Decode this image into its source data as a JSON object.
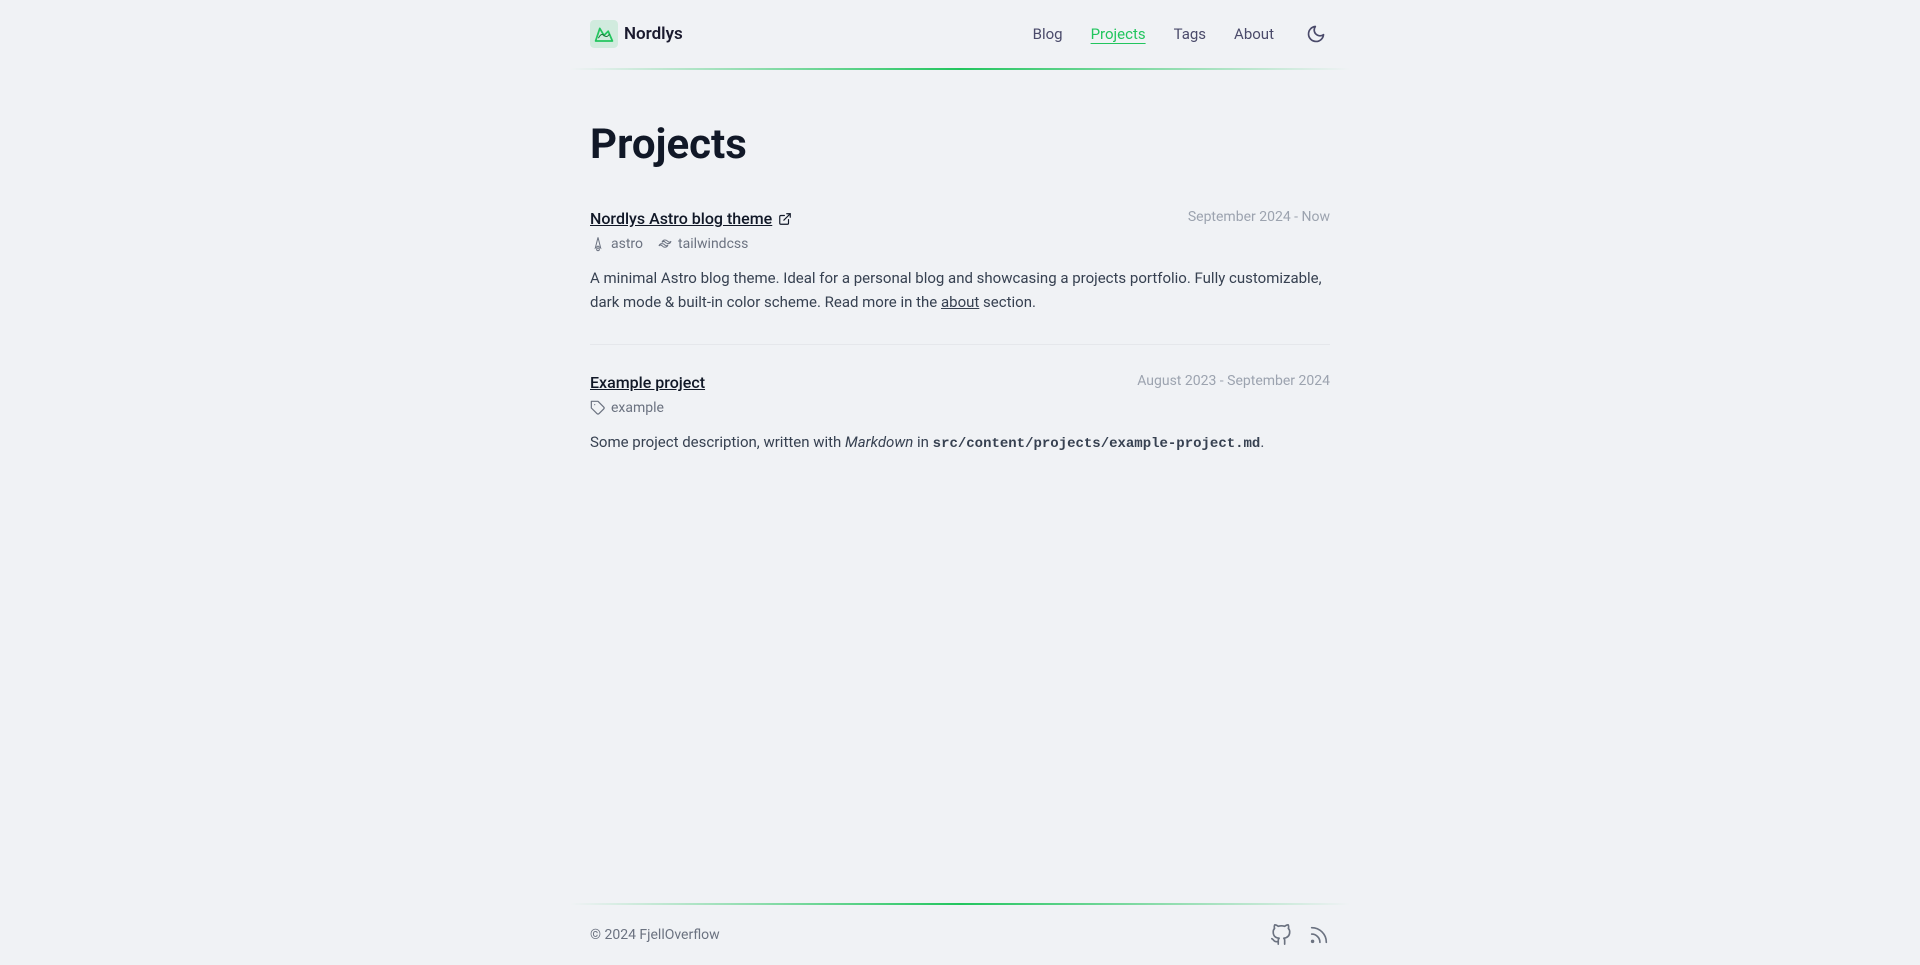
{
  "site": {
    "logo_text": "Nordlys",
    "accent_color": "#22c55e"
  },
  "nav": {
    "items": [
      {
        "label": "Blog",
        "href": "#",
        "active": false
      },
      {
        "label": "Projects",
        "href": "#",
        "active": true
      },
      {
        "label": "Tags",
        "href": "#",
        "active": false
      },
      {
        "label": "About",
        "href": "#",
        "active": false
      }
    ]
  },
  "main": {
    "page_title": "Projects"
  },
  "projects": [
    {
      "title": "Nordlys Astro blog theme",
      "has_external_link": true,
      "date": "September 2024 - Now",
      "tags": [
        {
          "name": "astro",
          "icon": "astro"
        },
        {
          "name": "tailwindcss",
          "icon": "tailwind"
        }
      ],
      "description_parts": [
        {
          "type": "text",
          "value": "A minimal Astro blog theme. Ideal for a personal blog and showcasing a projects portfolio. Fully customizable, dark mode & built-in color scheme. Read more in the "
        },
        {
          "type": "link",
          "value": "about"
        },
        {
          "type": "text",
          "value": " section."
        }
      ]
    },
    {
      "title": "Example project",
      "has_external_link": false,
      "date": "August 2023 - September 2024",
      "tags": [
        {
          "name": "example",
          "icon": "tag"
        }
      ],
      "description_parts": [
        {
          "type": "text",
          "value": "Some project description, written with "
        },
        {
          "type": "italic",
          "value": "Markdown"
        },
        {
          "type": "text",
          "value": " in "
        },
        {
          "type": "code",
          "value": "src/content/projects/example-project.md"
        },
        {
          "type": "text",
          "value": "."
        }
      ]
    }
  ],
  "footer": {
    "copyright": "© 2024 FjellOverflow"
  }
}
